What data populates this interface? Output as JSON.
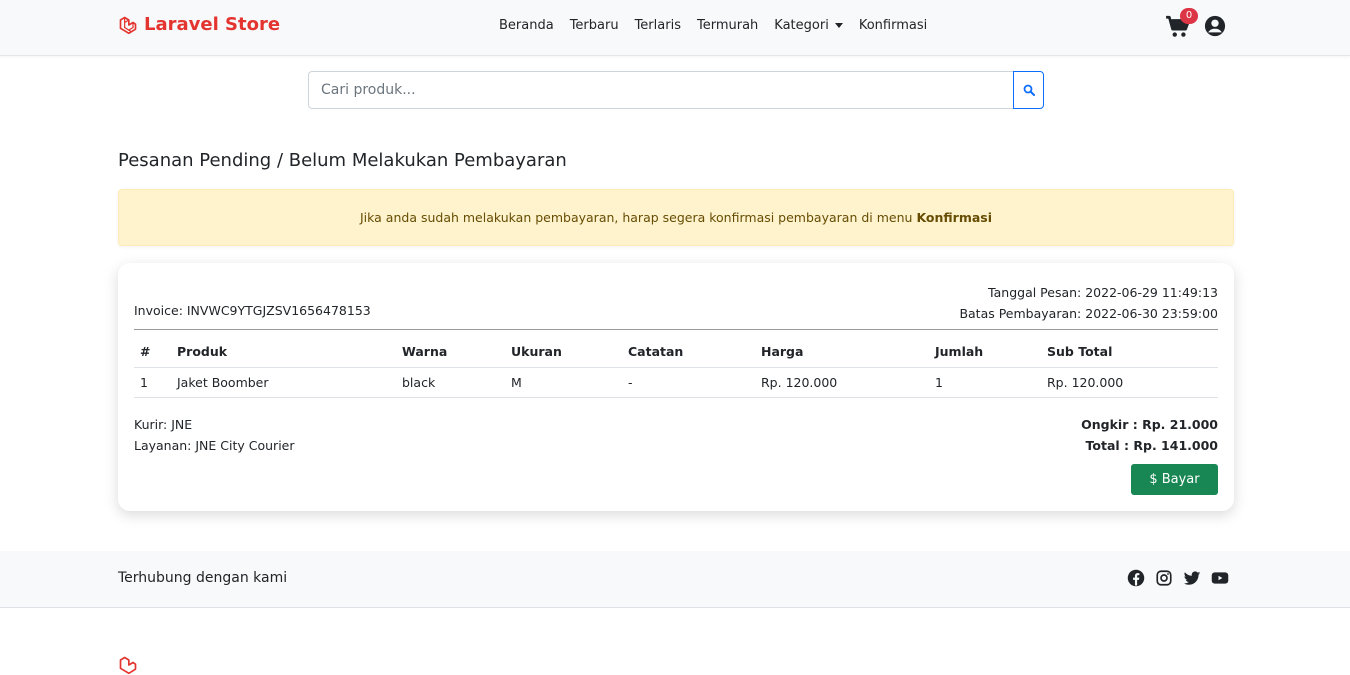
{
  "navbar": {
    "brand": "Laravel Store",
    "links": [
      "Beranda",
      "Terbaru",
      "Terlaris",
      "Termurah",
      "Kategori",
      "Konfirmasi"
    ],
    "cart_count": "0"
  },
  "search": {
    "placeholder": "Cari produk..."
  },
  "page_title": "Pesanan Pending / Belum Melakukan Pembayaran",
  "alert": {
    "text": "Jika anda sudah melakukan pembayaran, harap segera konfirmasi pembayaran di menu",
    "link": "Konfirmasi"
  },
  "order": {
    "invoice": "Invoice: INVWC9YTGJZSV1656478153",
    "tanggal": "Tanggal Pesan: 2022-06-29 11:49:13",
    "batas": "Batas Pembayaran: 2022-06-30 23:59:00",
    "columns": [
      "#",
      "Produk",
      "Warna",
      "Ukuran",
      "Catatan",
      "Harga",
      "Jumlah",
      "Sub Total"
    ],
    "rows": [
      [
        "1",
        "Jaket Boomber",
        "black",
        "M",
        "-",
        "Rp. 120.000",
        "1",
        "Rp. 120.000"
      ]
    ],
    "kurir": "Kurir: JNE",
    "layanan": "Layanan: JNE City Courier",
    "ongkir": "Ongkir : Rp. 21.000",
    "total": "Total : Rp. 141.000",
    "pay_label": "Bayar"
  },
  "footer": {
    "text": "Terhubung dengan kami"
  },
  "colors": {
    "brand": "#e3342f",
    "primary": "#0d6efd",
    "success": "#198754",
    "danger": "#dc3545",
    "alert_bg": "#fff3cd"
  },
  "icons": [
    "laravel-logo-icon",
    "cart-icon",
    "user-circle-icon",
    "search-icon",
    "dollar-icon",
    "facebook-icon",
    "instagram-icon",
    "twitter-icon",
    "youtube-icon"
  ]
}
